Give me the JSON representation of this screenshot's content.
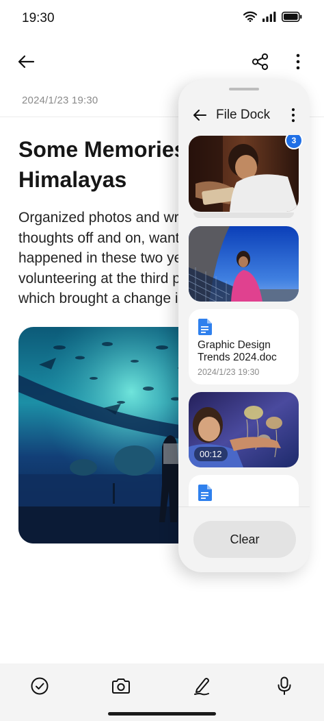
{
  "status_bar": {
    "time": "19:30"
  },
  "note": {
    "date": "2024/1/23  19:30",
    "title": "Some Memories of the Himalayas",
    "body": "Organized photos and wrote down some thoughts off and on, wanting to record what happened in these two years of living and volunteering at the third pole of the earth, which brought a change in me."
  },
  "file_dock": {
    "title": "File Dock",
    "stack_count": "3",
    "items": [
      {
        "type": "image",
        "name": "boy-reading-photo"
      },
      {
        "type": "image",
        "name": "girl-pink-sweater-photo"
      },
      {
        "type": "document",
        "name": "Graphic Design Trends 2024.doc",
        "date": "2024/1/23  19:30"
      },
      {
        "type": "video",
        "duration": "00:12"
      },
      {
        "type": "document",
        "name": ""
      }
    ],
    "clear_label": "Clear"
  },
  "colors": {
    "accent": "#1f6fe6",
    "doc_icon": "#2f80ed"
  },
  "icons": {
    "back": "arrow-left-icon",
    "share": "share-icon",
    "more": "more-vertical-icon",
    "checklist": "check-circle-icon",
    "camera": "camera-icon",
    "handwrite": "pen-icon",
    "voice": "microphone-icon"
  }
}
